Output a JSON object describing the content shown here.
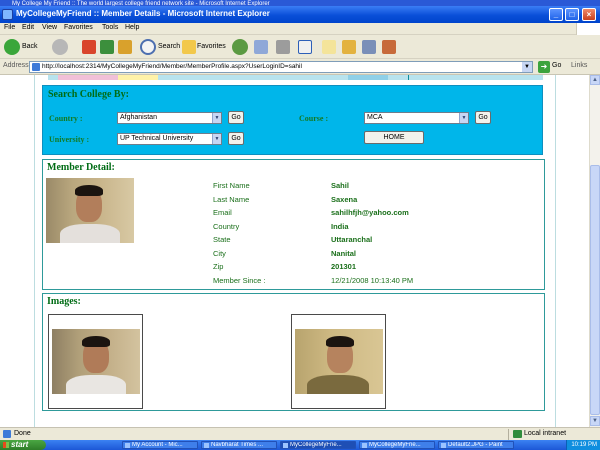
{
  "window": {
    "background_title": "My College My Friend :: The world largest college friend network site - Microsoft Internet Explorer",
    "title": "MyCollegeMyFriend :: Member Details - Microsoft Internet Explorer"
  },
  "menu": [
    "File",
    "Edit",
    "View",
    "Favorites",
    "Tools",
    "Help"
  ],
  "toolbar": {
    "back_label": "Back",
    "search_label": "Search",
    "favorites_label": "Favorites"
  },
  "address": {
    "label": "Address",
    "url": "http://localhost:2314/MyCollegeMyFriend/Member/MemberProfile.aspx?UserLoginID=sahil",
    "go_label": "Go",
    "links_label": "Links"
  },
  "search": {
    "title": "Search College By:",
    "country_label": "Country :",
    "country_value": "Afghanistan",
    "university_label": "University :",
    "university_value": "UP Technical University",
    "course_label": "Course :",
    "course_value": "MCA",
    "go_label": "Go",
    "home_label": "HOME"
  },
  "member_detail": {
    "title": "Member Detail:",
    "fields": [
      {
        "label": "First Name",
        "value": "Sahil"
      },
      {
        "label": "Last Name",
        "value": "Saxena"
      },
      {
        "label": "Email",
        "value": "sahilhfjh@yahoo.com"
      },
      {
        "label": "Country",
        "value": "India"
      },
      {
        "label": "State",
        "value": "Uttaranchal"
      },
      {
        "label": "City",
        "value": "Nanital"
      },
      {
        "label": "Zip",
        "value": "201301"
      },
      {
        "label": "Member Since :",
        "value": "12/21/2008 10:13:40 PM"
      }
    ]
  },
  "images": {
    "title": "Images:"
  },
  "status": {
    "text": "Done",
    "zone": "Local intranet"
  },
  "taskbar": {
    "start_label": "start",
    "items": [
      "My Account - Mic...",
      "Navbharat Times ...",
      "MyCollegeMyFrie...",
      "MyCollegeMyFrie...",
      "Default2.JPG - Paint"
    ],
    "clock": "10:19 PM"
  },
  "colors": {
    "search_panel": "#00b6ea",
    "heading_green": "#006c15",
    "text_green": "#1a6f1a",
    "xp_blue": "#0a4fd8"
  },
  "icons": [
    "back-arrow-icon",
    "forward-arrow-icon",
    "stop-icon",
    "refresh-icon",
    "home-icon",
    "search-icon",
    "favorites-star-icon",
    "history-icon",
    "mail-icon",
    "print-icon",
    "word-icon",
    "go-arrow-icon"
  ]
}
